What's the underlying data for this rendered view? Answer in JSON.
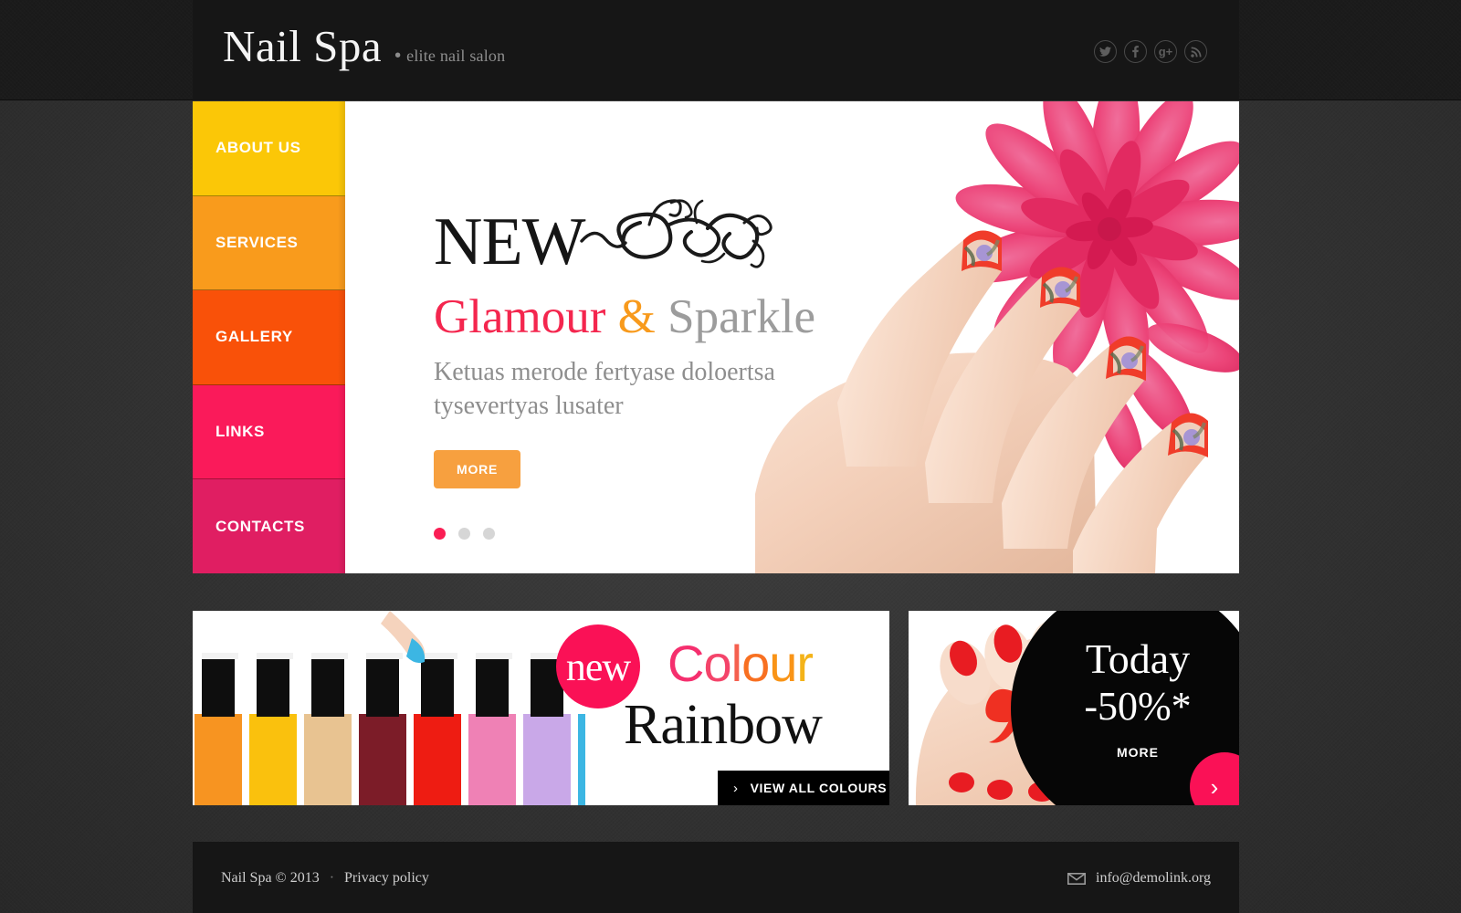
{
  "header": {
    "logo": "Nail Spa",
    "logo_separator": "•",
    "tagline": "elite nail salon",
    "social": [
      {
        "name": "twitter-icon",
        "label": "Twitter"
      },
      {
        "name": "facebook-icon",
        "label": "f"
      },
      {
        "name": "googleplus-icon",
        "label": "g+"
      },
      {
        "name": "rss-icon",
        "label": "RSS"
      }
    ]
  },
  "nav": {
    "items": [
      {
        "label": "ABOUT US",
        "color": "#fbc707",
        "name": "about-us"
      },
      {
        "label": "SERVICES",
        "color": "#f99b1c",
        "name": "services"
      },
      {
        "label": "GALLERY",
        "color": "#f95109",
        "name": "gallery"
      },
      {
        "label": "LINKS",
        "color": "#fa1a5a",
        "name": "links"
      },
      {
        "label": "CONTACTS",
        "color": "#e01e62",
        "name": "contacts"
      }
    ]
  },
  "slider": {
    "kicker": "NEW",
    "title_part1": "Glamour",
    "title_amp": "&",
    "title_part2": "Sparkle",
    "subtitle": "Ketuas merode fertyase doloertsa tysevertyas lusater",
    "more_label": "MORE",
    "dots": [
      "1",
      "2",
      "3"
    ],
    "active_dot": 0,
    "colors": {
      "glamour": "#f4264e",
      "amp": "#f89a1c",
      "sparkle": "#9c9c9c",
      "more_button": "#f7a03f",
      "active_dot": "#fa1e54"
    }
  },
  "banner_left": {
    "badge": "new",
    "colour_word": "Colour",
    "rainbow_word": "Rainbow",
    "button_label": "VIEW ALL COLOURS",
    "button_chevron": "›",
    "badge_color": "#fa1156"
  },
  "banner_right": {
    "today": "Today",
    "discount": "-50%*",
    "more_label": "MORE",
    "arrow": "›",
    "arrow_color": "#fa1156"
  },
  "footer": {
    "copyright": "Nail Spa © 2013",
    "separator": "·",
    "privacy": "Privacy policy",
    "email": "info@demolink.org",
    "email_icon": "envelope-icon"
  }
}
